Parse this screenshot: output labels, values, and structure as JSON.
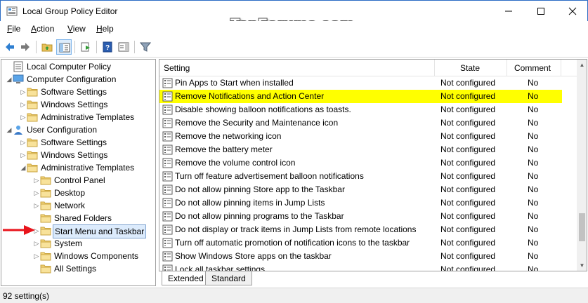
{
  "window": {
    "title": "Local Group Policy Editor",
    "watermark": "TenForums.com"
  },
  "menu": {
    "items": [
      {
        "label_u": "F",
        "label_rest": "ile"
      },
      {
        "label_u": "A",
        "label_rest": "ction"
      },
      {
        "label_u": "V",
        "label_rest": "iew"
      },
      {
        "label_u": "H",
        "label_rest": "elp"
      }
    ]
  },
  "toolbar": {
    "icons": [
      "back-arrow-icon",
      "forward-arrow-icon",
      "up-folder-icon",
      "show-hide-tree-icon",
      "export-list-icon",
      "help-icon",
      "properties-pane-icon",
      "filter-icon"
    ]
  },
  "tree": {
    "items": [
      {
        "label": "Local Computer Policy",
        "icon": "computer-policy-icon",
        "arrow": ""
      },
      {
        "label": "Computer Configuration",
        "icon": "computer-icon",
        "arrow": "expanded"
      },
      {
        "label": "Software Settings",
        "icon": "folder-icon",
        "arrow": "collapsed"
      },
      {
        "label": "Windows Settings",
        "icon": "folder-icon",
        "arrow": "collapsed"
      },
      {
        "label": "Administrative Templates",
        "icon": "folder-icon",
        "arrow": "collapsed"
      },
      {
        "label": "User Configuration",
        "icon": "user-icon",
        "arrow": "expanded"
      },
      {
        "label": "Software Settings",
        "icon": "folder-icon",
        "arrow": "collapsed"
      },
      {
        "label": "Windows Settings",
        "icon": "folder-icon",
        "arrow": "collapsed"
      },
      {
        "label": "Administrative Templates",
        "icon": "folder-icon",
        "arrow": "expanded"
      },
      {
        "label": "Control Panel",
        "icon": "folder-icon",
        "arrow": "collapsed"
      },
      {
        "label": "Desktop",
        "icon": "folder-icon",
        "arrow": "collapsed"
      },
      {
        "label": "Network",
        "icon": "folder-icon",
        "arrow": "collapsed"
      },
      {
        "label": "Shared Folders",
        "icon": "folder-icon",
        "arrow": ""
      },
      {
        "label": "Start Menu and Taskbar",
        "icon": "folder-icon",
        "arrow": "collapsed",
        "selected": true
      },
      {
        "label": "System",
        "icon": "folder-icon",
        "arrow": "collapsed"
      },
      {
        "label": "Windows Components",
        "icon": "folder-icon",
        "arrow": "collapsed"
      },
      {
        "label": "All Settings",
        "icon": "folder-icon",
        "arrow": ""
      }
    ]
  },
  "list": {
    "headers": {
      "setting": "Setting",
      "state": "State",
      "comment": "Comment"
    },
    "rows": [
      {
        "setting": "Pin Apps to Start when installed",
        "state": "Not configured",
        "comment": "No"
      },
      {
        "setting": "Remove Notifications and Action Center",
        "state": "Not configured",
        "comment": "No",
        "highlight": true
      },
      {
        "setting": "Disable showing balloon notifications as toasts.",
        "state": "Not configured",
        "comment": "No"
      },
      {
        "setting": "Remove the Security and Maintenance icon",
        "state": "Not configured",
        "comment": "No"
      },
      {
        "setting": "Remove the networking icon",
        "state": "Not configured",
        "comment": "No"
      },
      {
        "setting": "Remove the battery meter",
        "state": "Not configured",
        "comment": "No"
      },
      {
        "setting": "Remove the volume control icon",
        "state": "Not configured",
        "comment": "No"
      },
      {
        "setting": "Turn off feature advertisement balloon notifications",
        "state": "Not configured",
        "comment": "No"
      },
      {
        "setting": "Do not allow pinning Store app to the Taskbar",
        "state": "Not configured",
        "comment": "No"
      },
      {
        "setting": "Do not allow pinning items in Jump Lists",
        "state": "Not configured",
        "comment": "No"
      },
      {
        "setting": "Do not allow pinning programs to the Taskbar",
        "state": "Not configured",
        "comment": "No"
      },
      {
        "setting": "Do not display or track items in Jump Lists from remote locations",
        "state": "Not configured",
        "comment": "No"
      },
      {
        "setting": "Turn off automatic promotion of notification icons to the taskbar",
        "state": "Not configured",
        "comment": "No"
      },
      {
        "setting": "Show Windows Store apps on the taskbar",
        "state": "Not configured",
        "comment": "No"
      },
      {
        "setting": "Lock all taskbar settings",
        "state": "Not configured",
        "comment": "No"
      }
    ],
    "highlight_color": "#ffff00"
  },
  "tabs": {
    "extended": "Extended",
    "standard": "Standard"
  },
  "status": {
    "text": "92 setting(s)"
  },
  "colors": {
    "accent": "#2b6cc4",
    "annotation_arrow": "#e8141c"
  }
}
